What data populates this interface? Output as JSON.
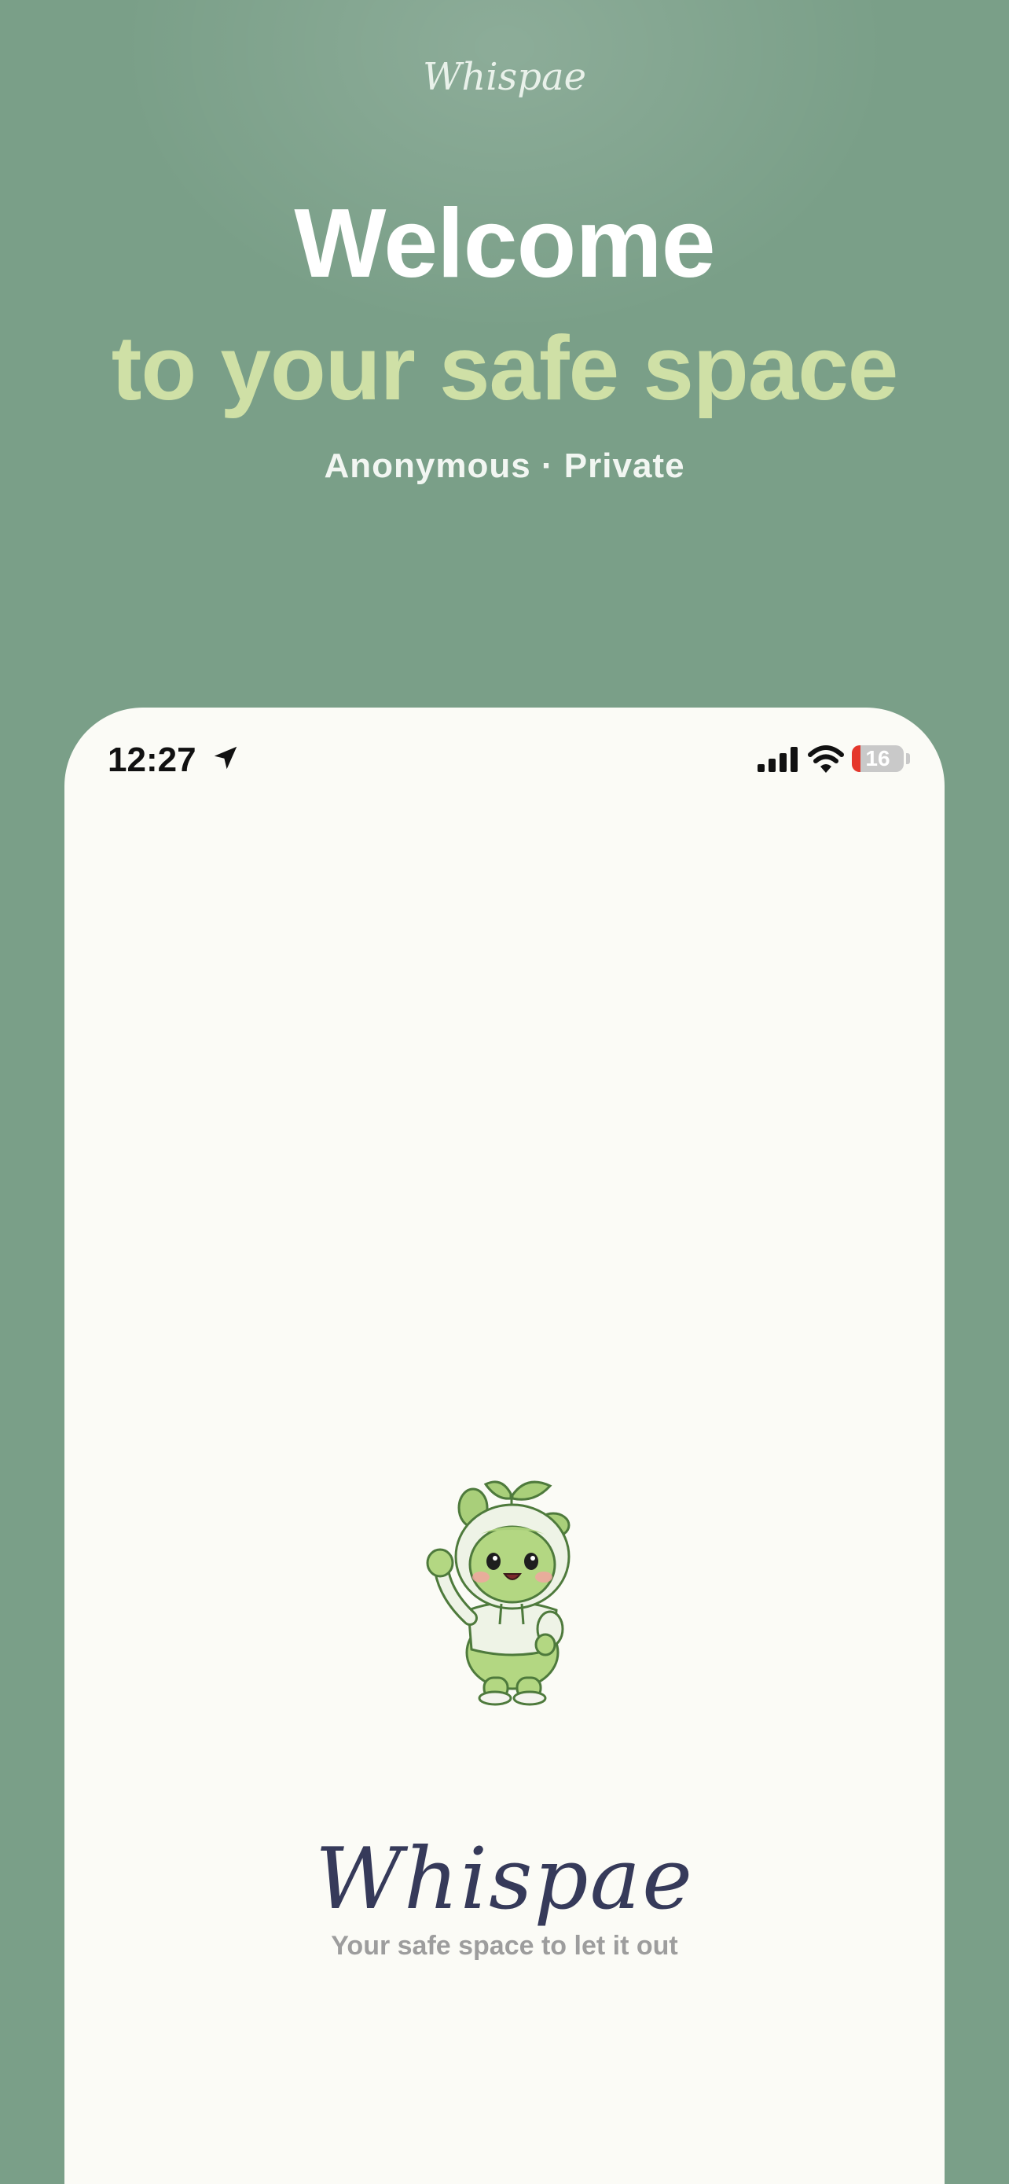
{
  "header": {
    "brand": "Whispae",
    "title": "Welcome",
    "subtitle": "to your safe space",
    "tagline": "Anonymous · Private"
  },
  "status_bar": {
    "time": "12:27",
    "battery_level": "16",
    "battery_fraction": 0.16,
    "location_icon": "location-arrow-icon",
    "signal_icon": "cellular-signal-icon",
    "wifi_icon": "wifi-icon"
  },
  "splash": {
    "mascot": "sprout-mascot",
    "logo": "Whispae",
    "tagline": "Your safe space to let it out"
  },
  "colors": {
    "background": "#7a9f88",
    "accent_green": "#cfe0a6",
    "card": "#fbfbf6",
    "logo": "#363a5a",
    "battery_low": "#e5372c"
  }
}
